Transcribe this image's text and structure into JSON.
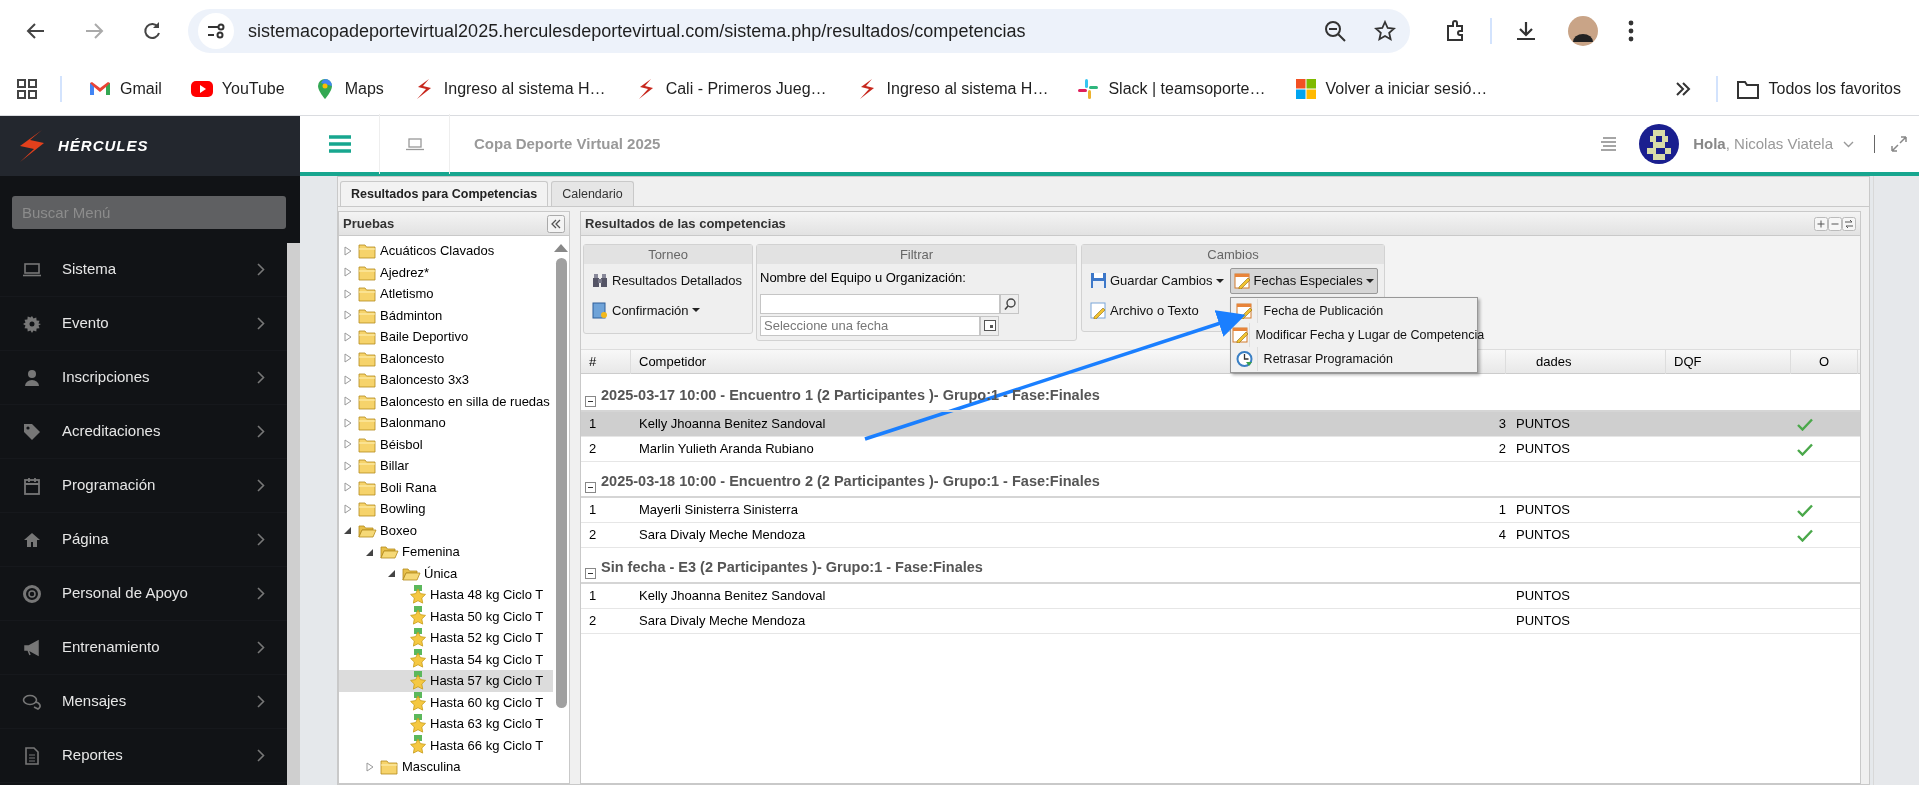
{
  "browser": {
    "url": "sistemacopadeportevirtual2025.herculesdeportevirtual.com/sistema.php/resultados/competencias",
    "bookmarks": [
      {
        "label": "Gmail"
      },
      {
        "label": "YouTube"
      },
      {
        "label": "Maps"
      },
      {
        "label": "Ingreso al sistema H…"
      },
      {
        "label": "Cali - Primeros Jueg…"
      },
      {
        "label": "Ingreso al sistema H…"
      },
      {
        "label": "Slack | teamsoporte…"
      },
      {
        "label": "Volver a iniciar sesió…"
      }
    ],
    "all_bookmarks": "Todos los favoritos"
  },
  "app": {
    "logo": "HÉRCULES",
    "title": "Copa Deporte Virtual 2025",
    "greeting": "**Hola**, Nicolas Viatela"
  },
  "sidebar": {
    "search_placeholder": "Buscar Menú",
    "items": [
      {
        "label": "Sistema"
      },
      {
        "label": "Evento"
      },
      {
        "label": "Inscripciones"
      },
      {
        "label": "Acreditaciones"
      },
      {
        "label": "Programación"
      },
      {
        "label": "Página"
      },
      {
        "label": "Personal de Apoyo"
      },
      {
        "label": "Entrenamiento"
      },
      {
        "label": "Mensajes"
      },
      {
        "label": "Reportes"
      }
    ]
  },
  "tabs": [
    {
      "label": "Resultados para Competencias",
      "selected": true
    },
    {
      "label": "Calendario",
      "selected": false
    }
  ],
  "tree": {
    "title": "Pruebas",
    "items": [
      {
        "kind": "folder",
        "label": "Acuáticos Clavados",
        "expanded": false,
        "selected": false
      },
      {
        "kind": "folder",
        "label": "Ajedrez*",
        "expanded": false,
        "selected": false
      },
      {
        "kind": "folder",
        "label": "Atletismo",
        "expanded": false,
        "selected": false
      },
      {
        "kind": "folder",
        "label": "Bádminton",
        "expanded": false,
        "selected": false
      },
      {
        "kind": "folder",
        "label": "Baile Deportivo",
        "expanded": false,
        "selected": false
      },
      {
        "kind": "folder",
        "label": "Baloncesto",
        "expanded": false,
        "selected": false
      },
      {
        "kind": "folder",
        "label": "Baloncesto 3x3",
        "expanded": false,
        "selected": false
      },
      {
        "kind": "folder",
        "label": "Baloncesto en silla de ruedas",
        "expanded": false,
        "selected": false
      },
      {
        "kind": "folder",
        "label": "Balonmano",
        "expanded": false,
        "selected": false
      },
      {
        "kind": "folder",
        "label": "Béisbol",
        "expanded": false,
        "selected": false
      },
      {
        "kind": "folder",
        "label": "Billar",
        "expanded": false,
        "selected": false
      },
      {
        "kind": "folder",
        "label": "Boli Rana",
        "expanded": false,
        "selected": false
      },
      {
        "kind": "folder",
        "label": "Bowling",
        "expanded": false,
        "selected": false
      },
      {
        "kind": "folder",
        "label": "Boxeo",
        "expanded": true,
        "selected": false,
        "children": [
          {
            "kind": "folder",
            "label": "Femenina",
            "expanded": true,
            "selected": false,
            "children": [
              {
                "kind": "folder",
                "label": "Única",
                "expanded": true,
                "selected": false,
                "children": [
                  {
                    "kind": "event",
                    "label": "Hasta 48 kg Ciclo T",
                    "selected": false
                  },
                  {
                    "kind": "event",
                    "label": "Hasta 50 kg Ciclo T",
                    "selected": false
                  },
                  {
                    "kind": "event",
                    "label": "Hasta 52 kg Ciclo T",
                    "selected": false
                  },
                  {
                    "kind": "event",
                    "label": "Hasta 54 kg Ciclo T",
                    "selected": false
                  },
                  {
                    "kind": "event",
                    "label": "Hasta 57 kg Ciclo T",
                    "selected": true
                  },
                  {
                    "kind": "event",
                    "label": "Hasta 60 kg Ciclo T",
                    "selected": false
                  },
                  {
                    "kind": "event",
                    "label": "Hasta 63 kg Ciclo T",
                    "selected": false
                  },
                  {
                    "kind": "event",
                    "label": "Hasta 66 kg Ciclo T",
                    "selected": false
                  }
                ]
              }
            ]
          },
          {
            "kind": "folder",
            "label": "Masculina",
            "expanded": false,
            "selected": false
          }
        ]
      }
    ]
  },
  "results": {
    "title": "Resultados de las competencias",
    "toolbar": {
      "torneo": {
        "title": "Torneo",
        "buttons": [
          {
            "label": "Resultados Detallados",
            "dropdown": false,
            "pressed": false
          },
          {
            "label": "Confirmación",
            "dropdown": true,
            "pressed": false
          }
        ]
      },
      "filtrar": {
        "title": "Filtrar",
        "label": "Nombre del Equipo u Organización:",
        "date_placeholder": "Seleccione una fecha"
      },
      "cambios": {
        "title": "Cambios",
        "buttons": [
          {
            "label": "Guardar Cambios",
            "dropdown": true,
            "pressed": false
          },
          {
            "label": "Fechas Especiales",
            "dropdown": true,
            "pressed": true,
            "menu": [
              {
                "label": "Fecha de Publicación"
              },
              {
                "label": "Modificar Fecha y Lugar de Competencia"
              },
              {
                "label": "Retrasar Programación"
              }
            ]
          },
          {
            "label": "Archivo o Texto",
            "dropdown": false,
            "pressed": false
          }
        ]
      }
    },
    "columns": [
      {
        "label": "#"
      },
      {
        "label": "Competidor"
      },
      {
        "label": "dades"
      },
      {
        "label": "DQF"
      },
      {
        "label": "O"
      }
    ],
    "groups": [
      {
        "title": "2025-03-17 10:00 - Encuentro 1 (2 Participantes )- Grupo:1 - Fase:Finales",
        "rows": [
          {
            "num": "1",
            "name": "Kelly Jhoanna Benitez Sandoval",
            "score": "3",
            "unit": "PUNTOS",
            "confirmed": true,
            "selected": true
          },
          {
            "num": "2",
            "name": "Marlin Yulieth Aranda Rubiano",
            "score": "2",
            "unit": "PUNTOS",
            "confirmed": true,
            "selected": false
          }
        ]
      },
      {
        "title": "2025-03-18 10:00 - Encuentro 2 (2 Participantes )- Grupo:1 - Fase:Finales",
        "rows": [
          {
            "num": "1",
            "name": "Mayerli Sinisterra Sinisterra",
            "score": "1",
            "unit": "PUNTOS",
            "confirmed": true,
            "selected": false
          },
          {
            "num": "2",
            "name": "Sara Divaly Meche Mendoza",
            "score": "4",
            "unit": "PUNTOS",
            "confirmed": true,
            "selected": false
          }
        ]
      },
      {
        "title": "Sin fecha - E3 (2 Participantes )- Grupo:1 - Fase:Finales",
        "rows": [
          {
            "num": "1",
            "name": "Kelly Jhoanna Benitez Sandoval",
            "unit": "PUNTOS",
            "confirmed": false,
            "selected": false
          },
          {
            "num": "2",
            "name": "Sara Divaly Meche Mendoza",
            "unit": "PUNTOS",
            "confirmed": false,
            "selected": false
          }
        ]
      }
    ]
  }
}
